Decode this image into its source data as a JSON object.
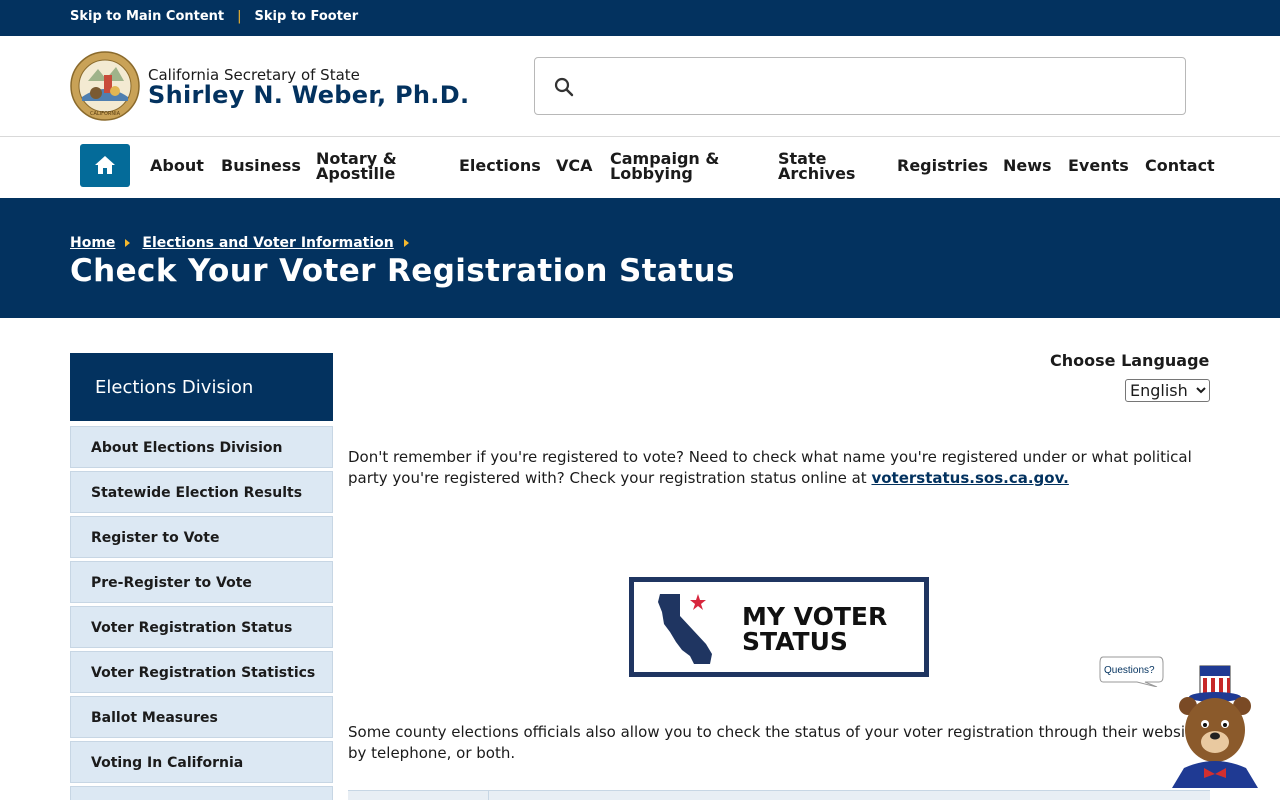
{
  "skip": {
    "main": "Skip to Main Content",
    "sep": "|",
    "footer": "Skip to Footer"
  },
  "header": {
    "agency": "California Secretary of State",
    "official": "Shirley N. Weber, Ph.D.",
    "search_placeholder": ""
  },
  "nav": {
    "items": [
      {
        "label": "About"
      },
      {
        "label": "Business"
      },
      {
        "label": "Notary & Apostille"
      },
      {
        "label": "Elections"
      },
      {
        "label": "VCA"
      },
      {
        "label": "Campaign & Lobbying"
      },
      {
        "label": "State Archives"
      },
      {
        "label": "Registries"
      },
      {
        "label": "News"
      },
      {
        "label": "Events"
      },
      {
        "label": "Contact"
      }
    ]
  },
  "breadcrumb": {
    "home": "Home",
    "section": "Elections and Voter Information"
  },
  "page_title": "Check Your Voter Registration Status",
  "sidebar": {
    "title": "Elections Division",
    "items": [
      {
        "label": "About Elections Division"
      },
      {
        "label": "Statewide Election Results"
      },
      {
        "label": "Register to Vote"
      },
      {
        "label": "Pre-Register to Vote"
      },
      {
        "label": "Voter Registration Status"
      },
      {
        "label": "Voter Registration Statistics"
      },
      {
        "label": "Ballot Measures"
      },
      {
        "label": "Voting In California"
      }
    ]
  },
  "language": {
    "label": "Choose Language",
    "selected": "English"
  },
  "content": {
    "intro_text": "Don't remember if you're registered to vote? Need to check what name you're registered under or what political party you're registered with? Check your registration status online at ",
    "intro_link": "voterstatus.sos.ca.gov.",
    "banner_line1": "MY VOTER",
    "banner_line2": "STATUS",
    "county_text": "Some county elections officials also allow you to check the status of your voter registration through their website, by telephone, or both."
  },
  "chat": {
    "bubble": "Questions?"
  },
  "colors": {
    "navy": "#03325f",
    "accent": "#f5b82e",
    "home_blue": "#046b99",
    "sidebar_bg": "#dce8f3"
  }
}
